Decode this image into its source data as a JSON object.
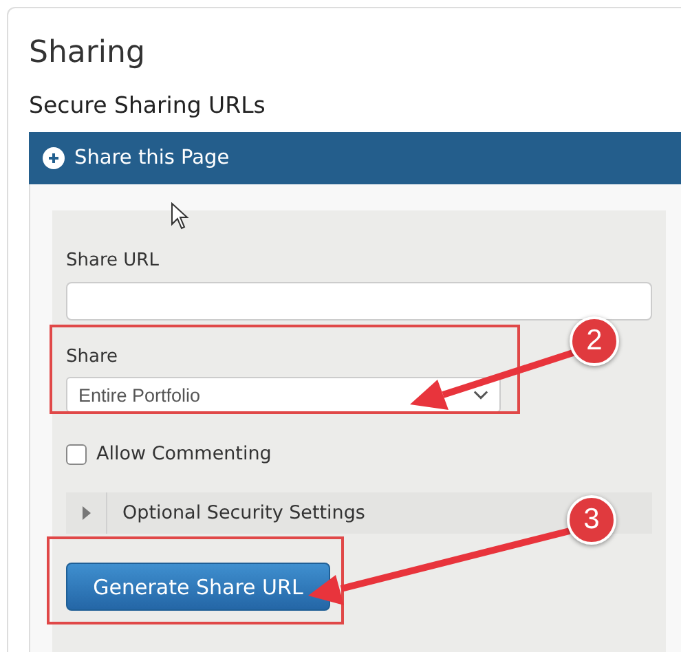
{
  "page": {
    "title": "Sharing",
    "section_title": "Secure Sharing URLs"
  },
  "accordion": {
    "title": "Share this Page"
  },
  "form": {
    "url_label": "Share URL",
    "share_label": "Share",
    "share_value": "Entire Portfolio",
    "allow_commenting": {
      "label": "Allow Commenting",
      "checked": false
    },
    "security": {
      "label": "Optional Security Settings",
      "expanded": false
    },
    "button": "Generate Share URL"
  },
  "callouts": [
    {
      "number": "2"
    },
    {
      "number": "3"
    }
  ]
}
